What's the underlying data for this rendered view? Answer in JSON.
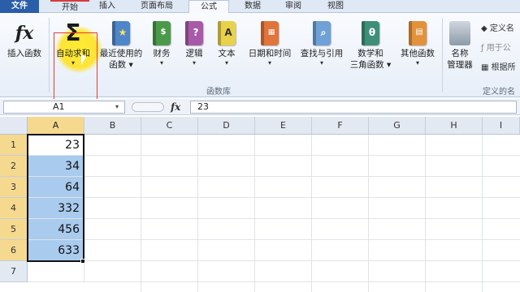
{
  "tabs": {
    "file": "文件",
    "home": "开始",
    "insert": "插入",
    "layout": "页面布局",
    "formulas": "公式",
    "data": "数据",
    "review": "审阅",
    "view": "视图"
  },
  "ribbon": {
    "insert_function": "插入函数",
    "autosum": "自动求和",
    "recent_line1": "最近使用的",
    "recent_line2": "函数",
    "financial": "财务",
    "logical": "逻辑",
    "text": "文本",
    "datetime": "日期和时间",
    "lookup": "查找与引用",
    "math_line1": "数学和",
    "math_line2": "三角函数",
    "other": "其他函数",
    "name_line1": "名称",
    "name_line2": "管理器",
    "define_name": "定义名",
    "use_in_formula": "用于公",
    "create_from": "根据所",
    "group_library": "函数库",
    "group_names": "定义的名",
    "sigma": "Σ",
    "fx": "fx",
    "caret": "▾",
    "logical_glyph": "?",
    "text_glyph": "A",
    "math_glyph": "θ"
  },
  "formula_bar": {
    "name_box": "A1",
    "fx": "fx",
    "content": "23"
  },
  "grid": {
    "columns": [
      "A",
      "B",
      "C",
      "D",
      "E",
      "F",
      "G",
      "H",
      "I"
    ],
    "rows": [
      "1",
      "2",
      "3",
      "4",
      "5",
      "6",
      "7"
    ],
    "values": [
      "23",
      "34",
      "64",
      "332",
      "456",
      "633"
    ]
  },
  "colors": {
    "selection": "#a9cbee",
    "header_active": "#f5d98f",
    "annotation": "#e23b3b",
    "highlight": "#ffe11a"
  }
}
